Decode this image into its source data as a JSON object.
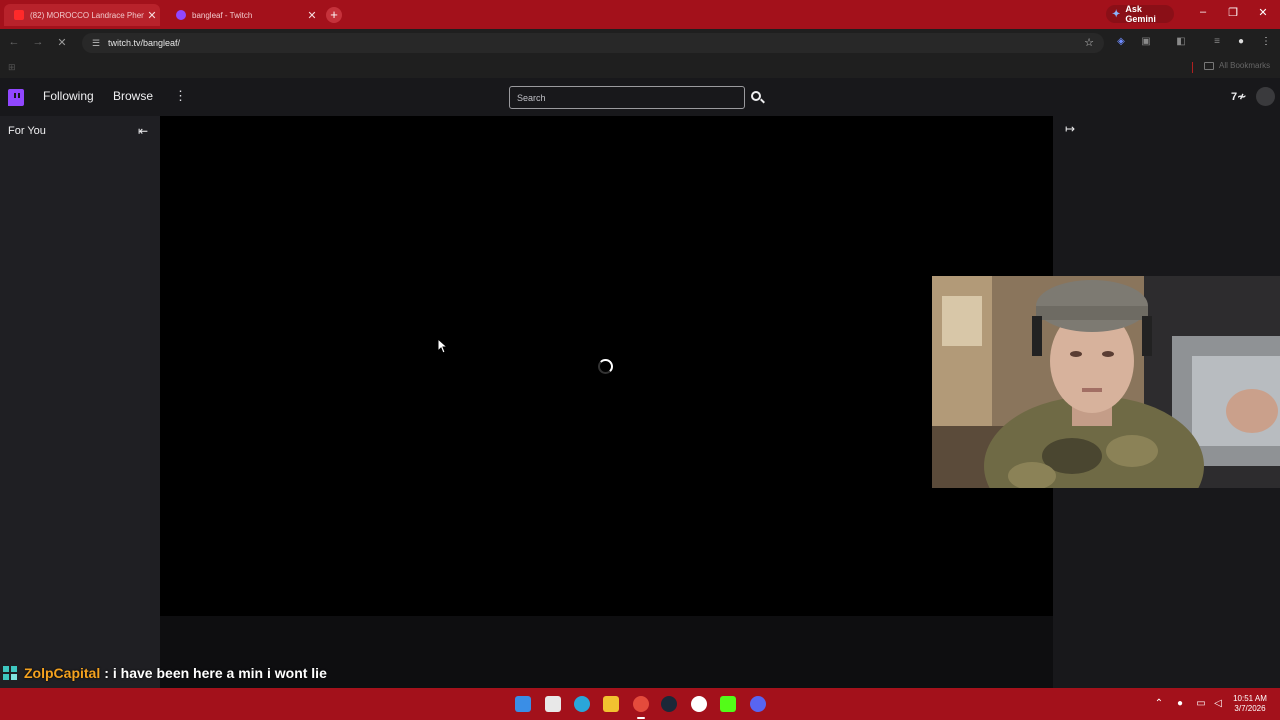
{
  "browser": {
    "tabs": [
      {
        "title": "(82) MOROCCO Landrace Phen",
        "favicon": "youtube-icon",
        "active": false
      },
      {
        "title": "bangleaf - Twitch",
        "favicon": "twitch-icon",
        "active": true
      }
    ],
    "new_tab_label": "+",
    "ask_gemini_label": "Ask Gemini",
    "url": "twitch.tv/bangleaf/",
    "bookmarks_all_label": "All Bookmarks",
    "accent": "#a3111b"
  },
  "twitch": {
    "nav": {
      "following_label": "Following",
      "browse_label": "Browse",
      "more_label": "⋮"
    },
    "search": {
      "placeholder": "Search"
    },
    "sidebar": {
      "for_you_label": "For You"
    },
    "brand_color": "#9147ff"
  },
  "chat_overlay": {
    "username": "ZolpCapital",
    "separator": ":",
    "message": "i have been here a min i wont lie",
    "username_color": "#f4a21f"
  },
  "taskbar": {
    "time": "10:51 AM",
    "date": "3/7/2026"
  }
}
